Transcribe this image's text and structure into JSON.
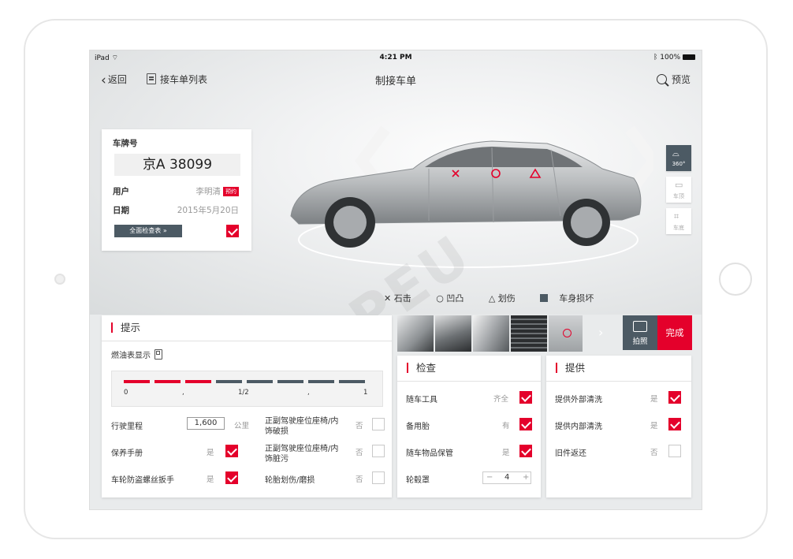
{
  "status": {
    "device": "iPad",
    "time": "4:21 PM",
    "battery": "100%"
  },
  "nav": {
    "back": "返回",
    "list": "接车单列表",
    "title": "制接车单",
    "preview": "预览"
  },
  "info": {
    "plate_label": "车牌号",
    "plate": "京A 38099",
    "user_label": "用户",
    "user": "李明清",
    "user_badge": "预约",
    "date_label": "日期",
    "date": "2015年5月20日",
    "full_check": "全面检查表"
  },
  "side": {
    "view360": "360°",
    "top": "车顶",
    "chassis": "车底"
  },
  "legend": {
    "stone": "石击",
    "dent": "凹凸",
    "scratch": "划伤",
    "damage": "车身损坏"
  },
  "tips": {
    "title": "提示",
    "fuel_label": "燃油表显示",
    "gauge": {
      "ticks": [
        "0",
        ",",
        "1/2",
        ",",
        "1"
      ],
      "level": 0.375
    },
    "items": [
      {
        "label": "行驶里程",
        "value": "1,600",
        "unit": "公里"
      },
      {
        "label": "保养手册",
        "state": "是",
        "checked": true
      },
      {
        "label": "车轮防盗螺丝扳手",
        "state": "是",
        "checked": true
      },
      {
        "label": "正副驾驶座位座椅/内饰破损",
        "state": "否",
        "checked": false
      },
      {
        "label": "正副驾驶座位座椅/内饰脏污",
        "state": "否",
        "checked": false
      },
      {
        "label": "轮胎划伤/磨损",
        "state": "否",
        "checked": false
      }
    ]
  },
  "photo_btn": "拍照",
  "done_btn": "完成",
  "check": {
    "title": "检查",
    "items": [
      {
        "label": "随车工具",
        "state": "齐全",
        "checked": true
      },
      {
        "label": "备用胎",
        "state": "有",
        "checked": true
      },
      {
        "label": "随车物品保管",
        "state": "是",
        "checked": true
      },
      {
        "label": "轮毂罩",
        "value": "4",
        "minus": "−",
        "plus": "+"
      }
    ]
  },
  "provide": {
    "title": "提供",
    "items": [
      {
        "label": "提供外部清洗",
        "state": "是",
        "checked": true
      },
      {
        "label": "提供内部清洗",
        "state": "是",
        "checked": true
      },
      {
        "label": "旧件返还",
        "state": "否",
        "checked": false
      }
    ]
  },
  "colors": {
    "accent": "#e4002b",
    "dark": "#4c5a64"
  },
  "icons": [
    "wifi-icon",
    "bluetooth-icon",
    "battery-icon",
    "back-chevron-icon",
    "document-icon",
    "search-icon",
    "car-360-icon",
    "car-top-icon",
    "car-chassis-icon",
    "fuel-pump-icon",
    "camera-icon",
    "next-arrow-icon"
  ]
}
